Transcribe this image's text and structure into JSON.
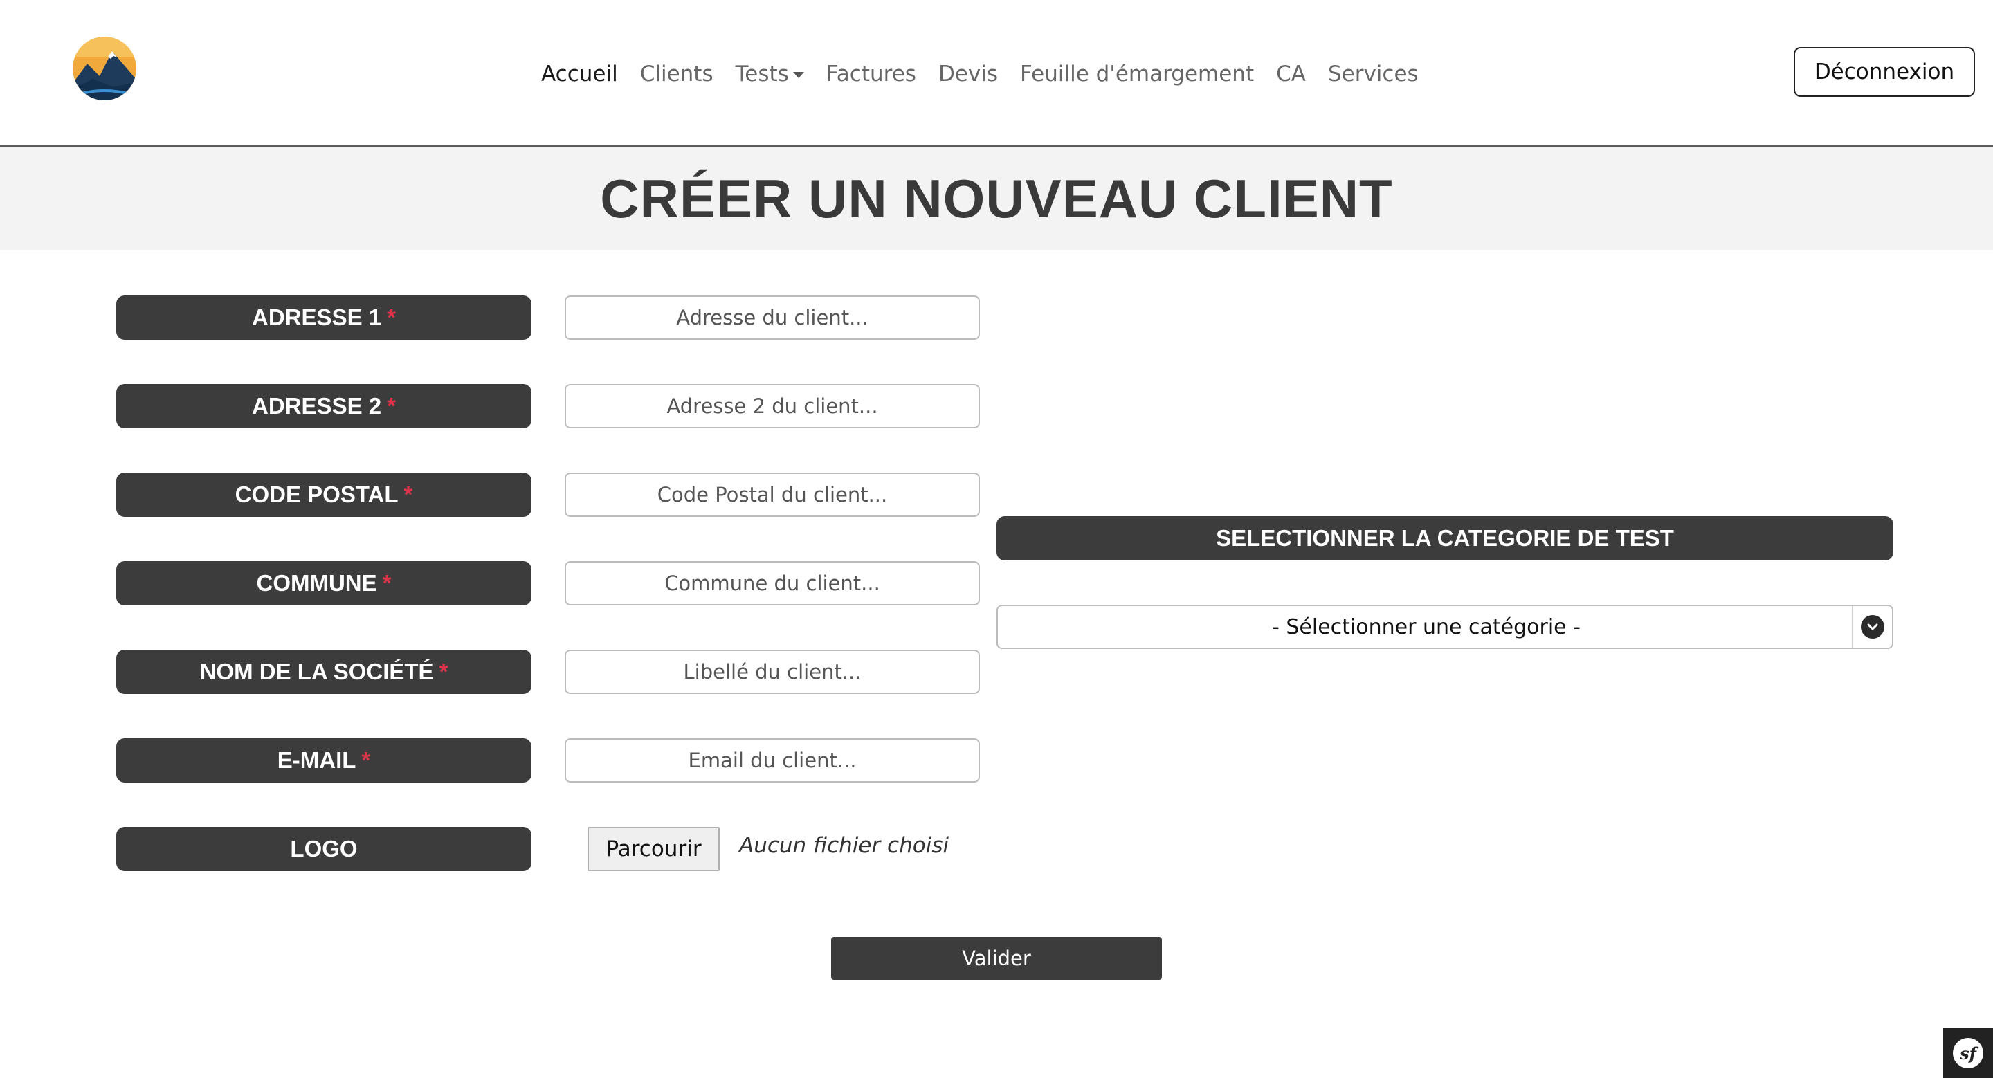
{
  "header": {
    "logo_name": "mountain-sunset-logo",
    "nav": [
      {
        "label": "Accueil",
        "active": true
      },
      {
        "label": "Clients",
        "active": false
      },
      {
        "label": "Tests",
        "active": false,
        "dropdown": true
      },
      {
        "label": "Factures",
        "active": false
      },
      {
        "label": "Devis",
        "active": false
      },
      {
        "label": "Feuille d'émargement",
        "active": false
      },
      {
        "label": "CA",
        "active": false
      },
      {
        "label": "Services",
        "active": false
      }
    ],
    "logout_label": "Déconnexion"
  },
  "page": {
    "title": "Créer un nouveau client"
  },
  "form": {
    "fields": [
      {
        "label": "Adresse 1",
        "required_mark": "*",
        "placeholder": "Adresse du client..."
      },
      {
        "label": "Adresse 2",
        "required_mark": "*",
        "placeholder": "Adresse 2 du client..."
      },
      {
        "label": "Code Postal",
        "required_mark": "*",
        "placeholder": "Code Postal du client..."
      },
      {
        "label": "Commune",
        "required_mark": "*",
        "placeholder": "Commune du client..."
      },
      {
        "label": "Nom de la société",
        "required_mark": "*",
        "placeholder": "Libellé du client..."
      },
      {
        "label": "E-mail",
        "required_mark": "*",
        "placeholder": "Email du client..."
      }
    ],
    "logo": {
      "label": "Logo",
      "browse_label": "Parcourir",
      "file_status": "Aucun fichier choisi"
    },
    "category": {
      "label": "Selectionner la categorie de test",
      "selected": "- Sélectionner une catégorie -"
    },
    "submit_label": "Valider"
  },
  "colors": {
    "label_bg": "#3c3c3c",
    "required": "#e0334b",
    "title_band": "#f3f3f3"
  },
  "debug_toolbar": {
    "icon": "symfony-logo-icon",
    "text": "sf"
  }
}
